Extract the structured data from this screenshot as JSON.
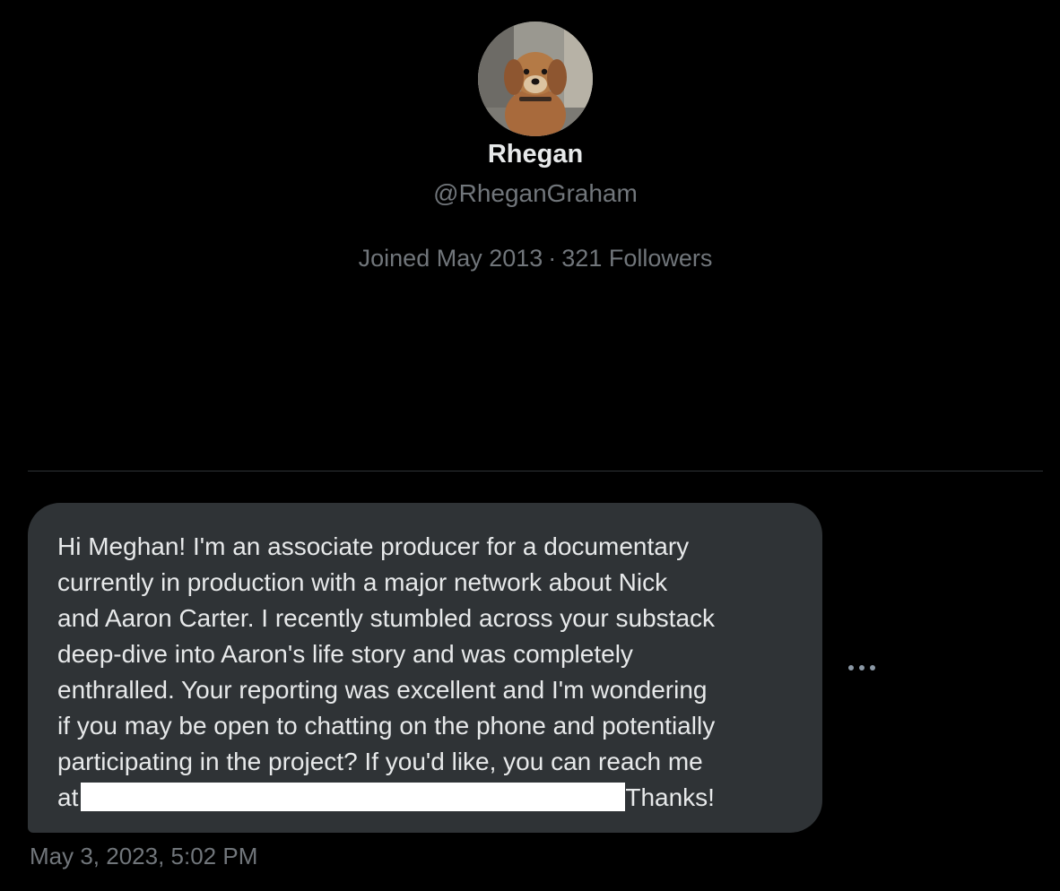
{
  "profile": {
    "display_name": "Rhegan",
    "handle": "@RheganGraham",
    "joined": "Joined May 2013",
    "separator": "·",
    "followers": "321 Followers",
    "avatar_icon": "dog-avatar"
  },
  "message": {
    "lines": [
      "Hi Meghan! I'm an associate producer for a documentary",
      "currently in production with a major network about Nick",
      "and Aaron Carter. I recently stumbled across your substack",
      "deep-dive into Aaron's life story and was completely",
      "enthralled. Your reporting was excellent and I'm wondering",
      "if you may be open to chatting on the phone and potentially",
      "participating in the project? If you'd like, you can reach me"
    ],
    "last_line_prefix": "at",
    "last_line_suffix": "Thanks!",
    "timestamp": "May 3, 2023, 5:02 PM",
    "bubble_color": "#2f3336",
    "more_icon": "more-horizontal-icon"
  }
}
